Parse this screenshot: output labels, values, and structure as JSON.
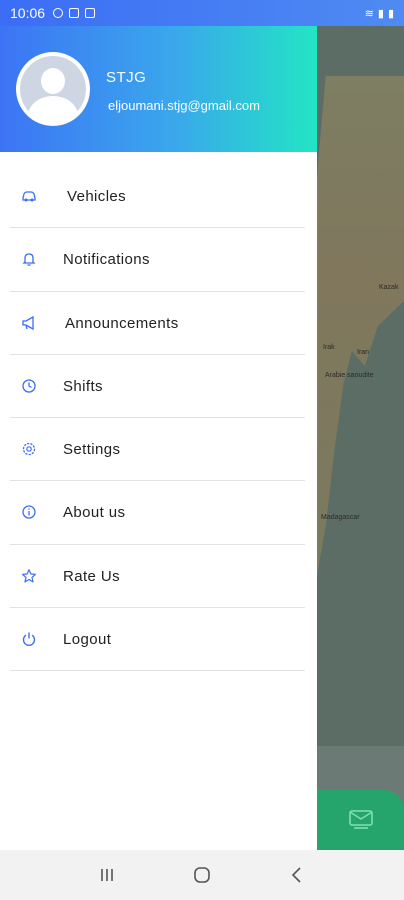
{
  "status_bar": {
    "time": "10:06"
  },
  "user": {
    "name": "STJG",
    "email": "eljoumani.stjg@gmail.com"
  },
  "menu": {
    "items": [
      {
        "label": "Vehicles",
        "icon": "car-icon"
      },
      {
        "label": "Notifications",
        "icon": "bell-icon"
      },
      {
        "label": "Announcements",
        "icon": "megaphone-icon"
      },
      {
        "label": "Shifts",
        "icon": "clock-icon"
      },
      {
        "label": "Settings",
        "icon": "gear-icon"
      },
      {
        "label": "About us",
        "icon": "info-icon"
      },
      {
        "label": "Rate Us",
        "icon": "star-icon"
      },
      {
        "label": "Logout",
        "icon": "power-icon"
      }
    ]
  },
  "map_labels": [
    "Kazak",
    "Irak",
    "Iran",
    "Arabie saoudite",
    "Madagascar"
  ],
  "colors": {
    "accent": "#3d74f5",
    "icon": "#3b6df5",
    "fab": "#25a46c"
  }
}
